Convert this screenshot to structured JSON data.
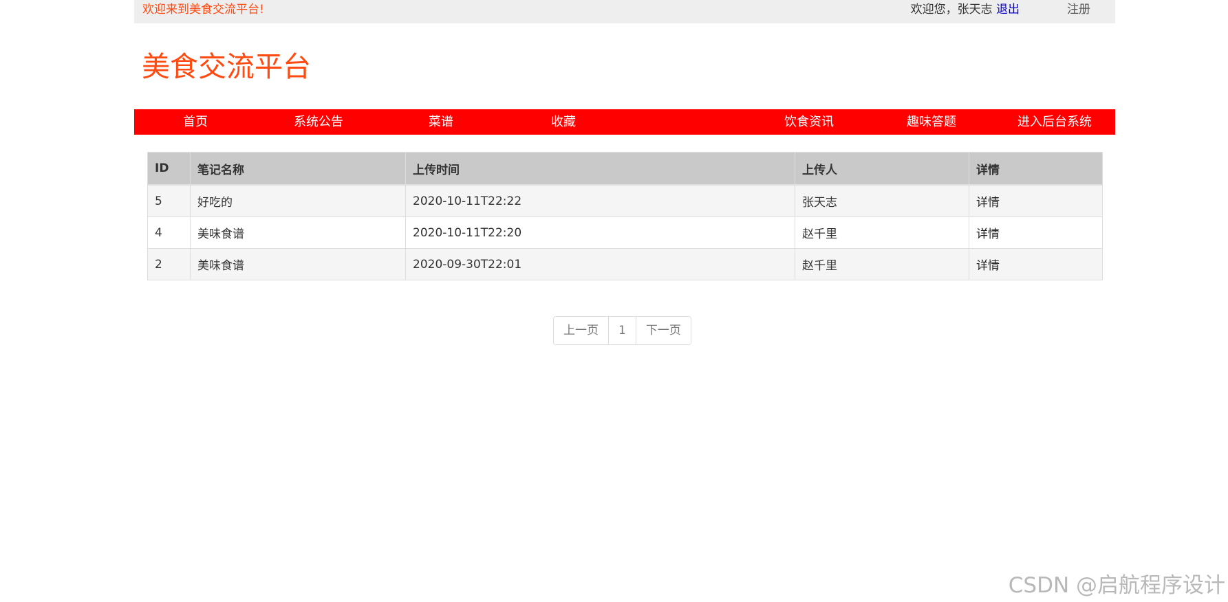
{
  "topbar": {
    "welcome_text": "欢迎来到美食交流平台!",
    "greeting": "欢迎您，张天志 ",
    "logout_label": "退出",
    "register_label": "注册"
  },
  "site": {
    "title": "美食交流平台"
  },
  "nav": {
    "items": [
      {
        "label": "首页"
      },
      {
        "label": "系统公告"
      },
      {
        "label": "菜谱"
      },
      {
        "label": "收藏"
      },
      {
        "label": "饮食资讯"
      },
      {
        "label": "趣味答题"
      },
      {
        "label": "进入后台系统"
      }
    ]
  },
  "table": {
    "headers": [
      "ID",
      "笔记名称",
      "上传时间",
      "上传人",
      "详情"
    ],
    "rows": [
      {
        "id": "5",
        "name": "好吃的",
        "time": "2020-10-11T22:22",
        "uploader": "张天志",
        "detail": "详情"
      },
      {
        "id": "4",
        "name": "美味食谱",
        "time": "2020-10-11T22:20",
        "uploader": "赵千里",
        "detail": "详情"
      },
      {
        "id": "2",
        "name": "美味食谱",
        "time": "2020-09-30T22:01",
        "uploader": "赵千里",
        "detail": "详情"
      }
    ]
  },
  "pagination": {
    "prev_label": "上一页",
    "current_page": "1",
    "next_label": "下一页"
  },
  "watermark": "CSDN @启航程序设计",
  "colors": {
    "accent": "#ff4a11",
    "nav_bg": "#ff0000",
    "logout_link": "#0a00cc"
  }
}
